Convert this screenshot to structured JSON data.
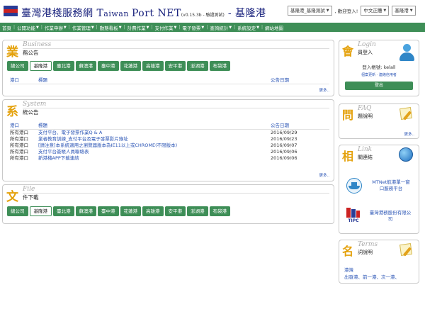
{
  "header": {
    "title_zh": "臺灣港棧服務網",
    "title_en_t": "T",
    "title_en_aiwan": "aiwan ",
    "title_en_port": "Port NET",
    "version": "(v0.15.3b - 驗證測試)",
    "title_port": "- 基隆港",
    "user_select": "基隆港_基隆測試",
    "welcome": ", 歡迎登入!",
    "lang_select": "中文正體",
    "port_select": "基隆港"
  },
  "nav": [
    {
      "label": "首頁",
      "dropdown": false
    },
    {
      "label": "公開功能",
      "dropdown": true
    },
    {
      "label": "作業申辦",
      "dropdown": true
    },
    {
      "label": "作業管理",
      "dropdown": true
    },
    {
      "label": "動態看板",
      "dropdown": true
    },
    {
      "label": "計費作業",
      "dropdown": true
    },
    {
      "label": "支付作業",
      "dropdown": true
    },
    {
      "label": "電子發票",
      "dropdown": true
    },
    {
      "label": "查詢統計",
      "dropdown": true
    },
    {
      "label": "系統設定",
      "dropdown": true
    },
    {
      "label": "網站地圖",
      "dropdown": false
    }
  ],
  "business": {
    "big_char": "業",
    "en": "Business",
    "zh": "務公告",
    "tabs": [
      "總公司",
      "基隆港",
      "臺北港",
      "蘇澳港",
      "臺中港",
      "花蓮港",
      "高雄港",
      "安平港",
      "澎湖港",
      "布袋港"
    ],
    "active_tab": 1,
    "col_port": "港口",
    "col_title": "標題",
    "col_date": "公告日期",
    "more": "更多.."
  },
  "system": {
    "big_char": "系",
    "en": "System",
    "zh": "統公告",
    "col_port": "港口",
    "col_title": "標題",
    "col_date": "公告日期",
    "rows": [
      {
        "port": "所有港口",
        "title": "支付平台、電子發票作業Q & A",
        "date": "2016/09/29"
      },
      {
        "port": "所有港口",
        "title": "業者教育訓練_支付平台及電子發票影片錄址",
        "date": "2016/09/23"
      },
      {
        "port": "所有港口",
        "title": "[請注意]本系統適用之瀏覽器版本為IE11以上或CHROME(不限版本)",
        "date": "2016/09/07"
      },
      {
        "port": "所有港口",
        "title": "支付平台簽帳人員聯絡表",
        "date": "2016/09/06"
      },
      {
        "port": "所有港口",
        "title": "新港棧APP下載連結",
        "date": "2016/09/06"
      }
    ],
    "more": "更多.."
  },
  "file": {
    "big_char": "文",
    "en": "File",
    "zh": "件下載",
    "tabs": [
      "總公司",
      "基隆港",
      "臺北港",
      "蘇澳港",
      "臺中港",
      "花蓮港",
      "高雄港",
      "安平港",
      "澎湖港",
      "布袋港"
    ],
    "active_tab": 1
  },
  "login": {
    "big_char": "會",
    "en": "Login",
    "zh": "員登入",
    "account": "登入帳號: kelall",
    "links": "個案更新 · 連絡信用者",
    "logout": "登出"
  },
  "faq": {
    "big_char": "問",
    "en": "FAQ",
    "zh": "題說明",
    "more": "更多.."
  },
  "link": {
    "big_char": "相",
    "en": "Link",
    "zh": "關連結",
    "item1_line1": "MTNet航港單一窗",
    "item1_line2": "口服務平台",
    "item2_line1": "臺灣港務股份有限公",
    "item2_line2": "司",
    "tipc": "TIPC"
  },
  "terms": {
    "big_char": "名",
    "en": "Terms",
    "zh": "詞說明",
    "head": "港灣",
    "items": "出發港、前一港、次一港、"
  },
  "colors": {
    "green": "#3e8e57",
    "orange": "#e4a10b",
    "link": "#2a54b5",
    "navy": "#1a237e"
  }
}
